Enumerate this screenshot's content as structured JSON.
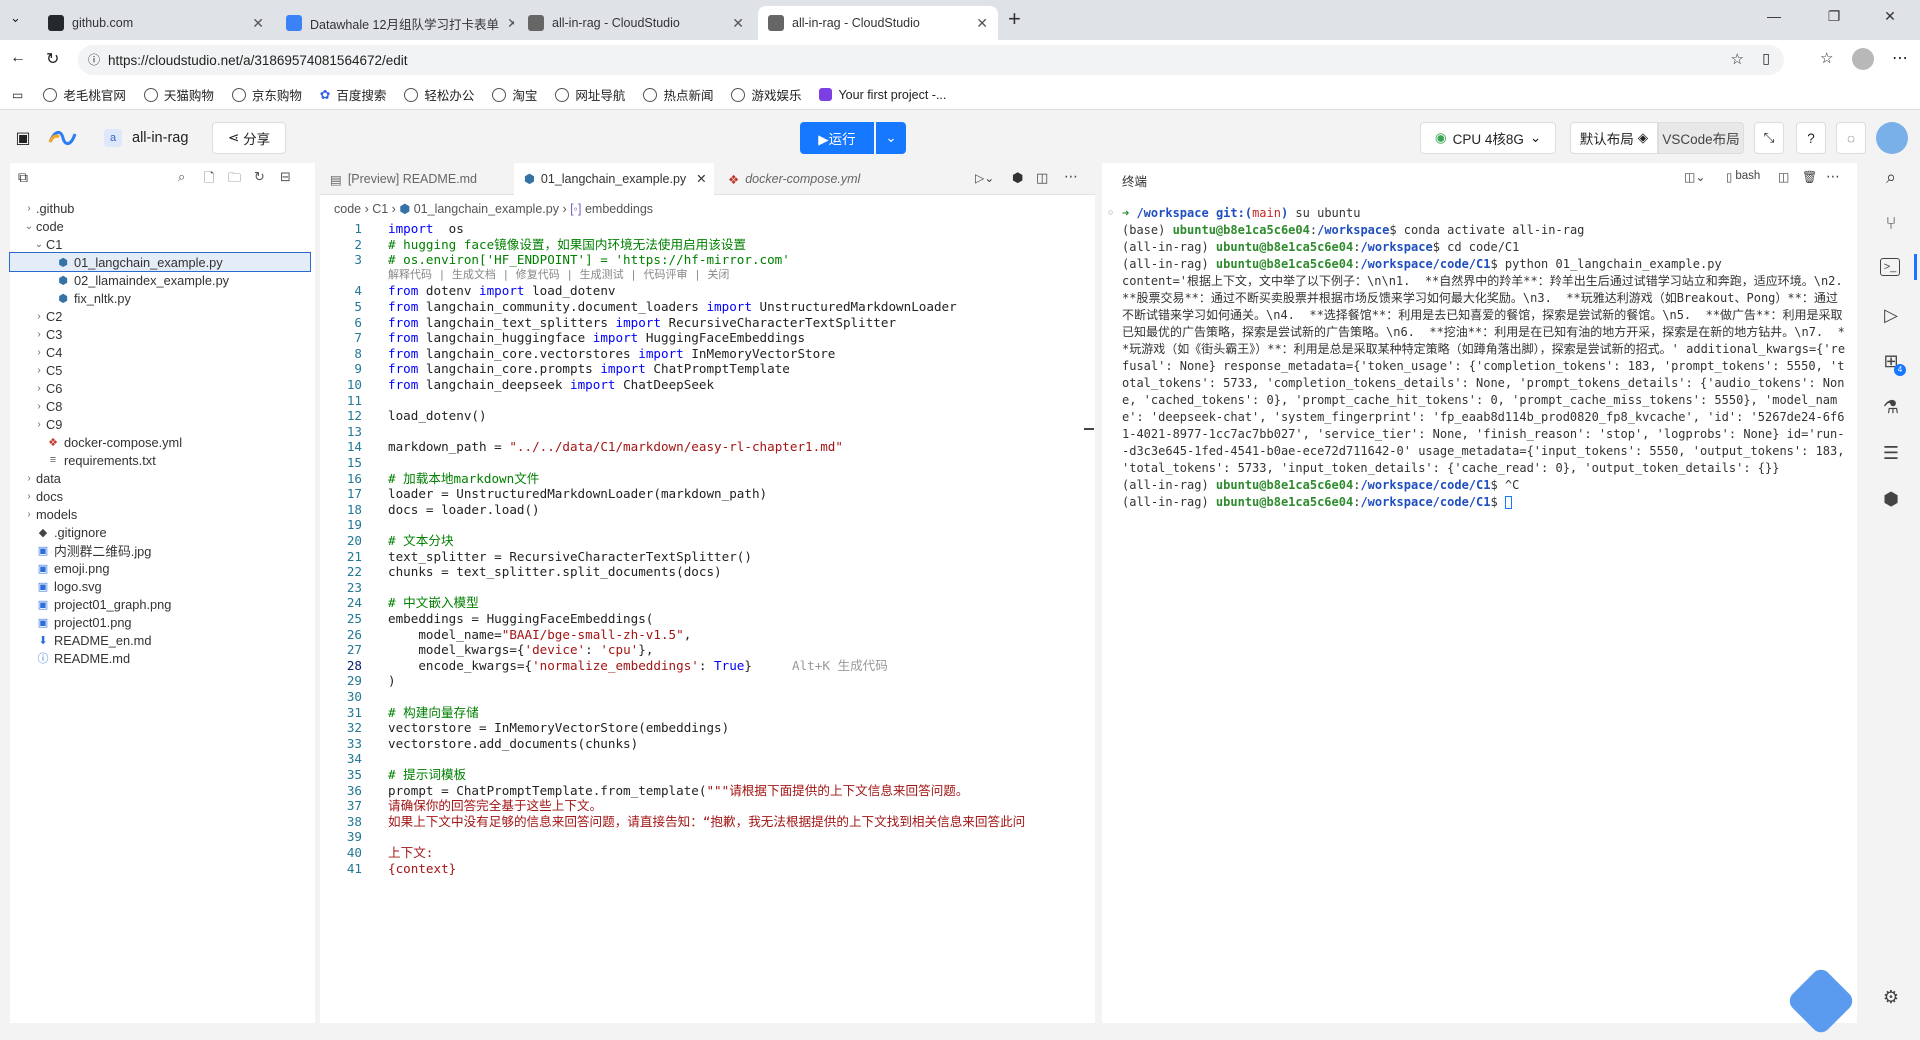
{
  "browser": {
    "tabs": [
      {
        "label": "github.com",
        "color": "#24292e"
      },
      {
        "label": "Datawhale 12月组队学习打卡表单",
        "color": "#3b82f6"
      },
      {
        "label": "all-in-rag - CloudStudio",
        "color": "#666666"
      },
      {
        "label": "all-in-rag - CloudStudio",
        "color": "#666666"
      }
    ],
    "url": "https://cloudstudio.net/a/31869574081564672/edit",
    "bookmarks": [
      "老毛桃官网",
      "天猫购物",
      "京东购物",
      "百度搜索",
      "轻松办公",
      "淘宝",
      "网址导航",
      "热点新闻",
      "游戏娱乐",
      "Your first project -..."
    ]
  },
  "app": {
    "workspace_badge": "a",
    "workspace": "all-in-rag",
    "share": "分享",
    "run": "▶运行",
    "cpu": "CPU 4核8G",
    "layout_default": "默认布局",
    "layout_vscode": "VSCode布局",
    "accent": "#1677ff"
  },
  "explorer": {
    "items": [
      {
        "label": ".github",
        "type": "folder",
        "depth": 0,
        "open": false
      },
      {
        "label": "code",
        "type": "folder",
        "depth": 0,
        "open": true
      },
      {
        "label": "C1",
        "type": "folder",
        "depth": 1,
        "open": true
      },
      {
        "label": "01_langchain_example.py",
        "type": "py",
        "depth": 2,
        "selected": true
      },
      {
        "label": "02_llamaindex_example.py",
        "type": "py",
        "depth": 2
      },
      {
        "label": "fix_nltk.py",
        "type": "py",
        "depth": 2
      },
      {
        "label": "C2",
        "type": "folder",
        "depth": 1
      },
      {
        "label": "C3",
        "type": "folder",
        "depth": 1
      },
      {
        "label": "C4",
        "type": "folder",
        "depth": 1
      },
      {
        "label": "C5",
        "type": "folder",
        "depth": 1
      },
      {
        "label": "C6",
        "type": "folder",
        "depth": 1
      },
      {
        "label": "C8",
        "type": "folder",
        "depth": 1
      },
      {
        "label": "C9",
        "type": "folder",
        "depth": 1
      },
      {
        "label": "docker-compose.yml",
        "type": "yml",
        "depth": 1
      },
      {
        "label": "requirements.txt",
        "type": "txt",
        "depth": 1
      },
      {
        "label": "data",
        "type": "folder",
        "depth": 0
      },
      {
        "label": "docs",
        "type": "folder",
        "depth": 0
      },
      {
        "label": "models",
        "type": "folder",
        "depth": 0
      },
      {
        "label": ".gitignore",
        "type": "git",
        "depth": 0
      },
      {
        "label": "内测群二维码.jpg",
        "type": "img",
        "depth": 0
      },
      {
        "label": "emoji.png",
        "type": "img",
        "depth": 0
      },
      {
        "label": "logo.svg",
        "type": "img",
        "depth": 0
      },
      {
        "label": "project01_graph.png",
        "type": "img",
        "depth": 0
      },
      {
        "label": "project01.png",
        "type": "img",
        "depth": 0
      },
      {
        "label": "README_en.md",
        "type": "md",
        "depth": 0
      },
      {
        "label": "README.md",
        "type": "info",
        "depth": 0
      }
    ]
  },
  "editor": {
    "tabs": [
      "[Preview] README.md",
      "01_langchain_example.py",
      "docker-compose.yml"
    ],
    "breadcrumb": [
      "code",
      "C1",
      "01_langchain_example.py",
      "embeddings"
    ],
    "codelens": "解释代码 | 生成文档 | 修复代码 | 生成测试 | 代码评审 | 关闭",
    "hint": "Alt+K 生成代码",
    "lines": [
      [
        [
          "kw",
          "import"
        ],
        [
          "",
          "  os"
        ]
      ],
      [
        [
          "cm",
          "# hugging face镜像设置，如果国内环境无法使用启用该设置"
        ]
      ],
      [
        [
          "cm",
          "# os.environ['HF_ENDPOINT'] = 'https://hf-mirror.com'"
        ]
      ],
      [
        [
          "kw",
          "from"
        ],
        [
          "",
          " dotenv "
        ],
        [
          "kw",
          "import"
        ],
        [
          "",
          " load_dotenv"
        ]
      ],
      [
        [
          "kw",
          "from"
        ],
        [
          "",
          " langchain_community.document_loaders "
        ],
        [
          "kw",
          "import"
        ],
        [
          "",
          " UnstructuredMarkdownLoader"
        ]
      ],
      [
        [
          "kw",
          "from"
        ],
        [
          "",
          " langchain_text_splitters "
        ],
        [
          "kw",
          "import"
        ],
        [
          "",
          " RecursiveCharacterTextSplitter"
        ]
      ],
      [
        [
          "kw",
          "from"
        ],
        [
          "",
          " langchain_huggingface "
        ],
        [
          "kw",
          "import"
        ],
        [
          "",
          " HuggingFaceEmbeddings"
        ]
      ],
      [
        [
          "kw",
          "from"
        ],
        [
          "",
          " langchain_core.vectorstores "
        ],
        [
          "kw",
          "import"
        ],
        [
          "",
          " InMemoryVectorStore"
        ]
      ],
      [
        [
          "kw",
          "from"
        ],
        [
          "",
          " langchain_core.prompts "
        ],
        [
          "kw",
          "import"
        ],
        [
          "",
          " ChatPromptTemplate"
        ]
      ],
      [
        [
          "kw",
          "from"
        ],
        [
          "",
          " langchain_deepseek "
        ],
        [
          "kw",
          "import"
        ],
        [
          "",
          " ChatDeepSeek"
        ]
      ],
      [],
      [
        [
          "",
          "load_dotenv()"
        ]
      ],
      [],
      [
        [
          "",
          "markdown_path = "
        ],
        [
          "st",
          "\"../../data/C1/markdown/easy-rl-chapter1.md\""
        ]
      ],
      [],
      [
        [
          "cm",
          "# 加载本地markdown文件"
        ]
      ],
      [
        [
          "",
          "loader = UnstructuredMarkdownLoader(markdown_path)"
        ]
      ],
      [
        [
          "",
          "docs = loader.load()"
        ]
      ],
      [],
      [
        [
          "cm",
          "# 文本分块"
        ]
      ],
      [
        [
          "",
          "text_splitter = RecursiveCharacterTextSplitter()"
        ]
      ],
      [
        [
          "",
          "chunks = text_splitter.split_documents(docs)"
        ]
      ],
      [],
      [
        [
          "cm",
          "# 中文嵌入模型"
        ]
      ],
      [
        [
          "",
          "embeddings = HuggingFaceEmbeddings("
        ]
      ],
      [
        [
          "",
          "    model_name="
        ],
        [
          "st",
          "\"BAAI/bge-small-zh-v1.5\""
        ],
        [
          "",
          ","
        ]
      ],
      [
        [
          "",
          "    model_kwargs={"
        ],
        [
          "st",
          "'device'"
        ],
        [
          "",
          ": "
        ],
        [
          "st",
          "'cpu'"
        ],
        [
          "",
          "},"
        ]
      ],
      [
        [
          "",
          "    encode_kwargs={"
        ],
        [
          "st",
          "'normalize_embeddings'"
        ],
        [
          "",
          ": "
        ],
        [
          "kw",
          "True"
        ],
        [
          "",
          "}"
        ]
      ],
      [
        [
          "",
          ")"
        ]
      ],
      [],
      [
        [
          "cm",
          "# 构建向量存储"
        ]
      ],
      [
        [
          "",
          "vectorstore = InMemoryVectorStore(embeddings)"
        ]
      ],
      [
        [
          "",
          "vectorstore.add_documents(chunks)"
        ]
      ],
      [],
      [
        [
          "cm",
          "# 提示词模板"
        ]
      ],
      [
        [
          "",
          "prompt = ChatPromptTemplate.from_template("
        ],
        [
          "st",
          "\"\"\"请根据下面提供的上下文信息来回答问题。"
        ]
      ],
      [
        [
          "st",
          "请确保你的回答完全基于这些上下文。"
        ]
      ],
      [
        [
          "st",
          "如果上下文中没有足够的信息来回答问题，请直接告知：“抱歉，我无法根据提供的上下文找到相关信息来回答此问"
        ]
      ],
      [],
      [
        [
          "st",
          "上下文:"
        ]
      ],
      [
        [
          "st",
          "{context}"
        ]
      ]
    ]
  },
  "terminal": {
    "title": "终端",
    "shell": "bash",
    "lines": [
      [
        [
          "tg",
          "➜ "
        ],
        [
          "tb",
          "/workspace "
        ],
        [
          "tb",
          "git:("
        ],
        [
          "tr",
          "main"
        ],
        [
          "tb",
          ")"
        ],
        [
          "",
          " su ubuntu"
        ]
      ],
      [
        [
          "",
          "(base) "
        ],
        [
          "tg",
          "ubuntu@b8e1ca5c6e04"
        ],
        [
          "",
          ":"
        ],
        [
          "tb",
          "/workspace"
        ],
        [
          "",
          "$ conda activate all-in-rag"
        ]
      ],
      [
        [
          "",
          "(all-in-rag) "
        ],
        [
          "tg",
          "ubuntu@b8e1ca5c6e04"
        ],
        [
          "",
          ":"
        ],
        [
          "tb",
          "/workspace"
        ],
        [
          "",
          "$ cd code/C1"
        ]
      ],
      [
        [
          "",
          "(all-in-rag) "
        ],
        [
          "tg",
          "ubuntu@b8e1ca5c6e04"
        ],
        [
          "",
          ":"
        ],
        [
          "tb",
          "/workspace/code/C1"
        ],
        [
          "",
          "$ python 01_langchain_example.py"
        ]
      ],
      [
        [
          "",
          "content='根据上下文，文中举了以下例子：\\n\\n1.  **自然界中的羚羊**：羚羊出生后通过试错学习站立和奔跑，适应环境。\\n2.  **股票交易**：通过不断买卖股票并根据市场反馈来学习如何最大化奖励。\\n3.  **玩雅达利游戏（如Breakout、Pong）**：通过不断试错来学习如何通关。\\n4.  **选择餐馆**：利用是去已知喜爱的餐馆，探索是尝试新的餐馆。\\n5.  **做广告**：利用是采取已知最优的广告策略，探索是尝试新的广告策略。\\n6.  **挖油**：利用是在已知有油的地方开采，探索是在新的地方钻井。\\n7.  **玩游戏（如《街头霸王》）**：利用是总是采取某种特定策略（如蹲角落出脚），探索是尝试新的招式。' additional_kwargs={'refusal': None} response_metadata={'token_usage': {'completion_tokens': 183, 'prompt_tokens': 5550, 'total_tokens': 5733, 'completion_tokens_details': None, 'prompt_tokens_details': {'audio_tokens': None, 'cached_tokens': 0}, 'prompt_cache_hit_tokens': 0, 'prompt_cache_miss_tokens': 5550}, 'model_name': 'deepseek-chat', 'system_fingerprint': 'fp_eaab8d114b_prod0820_fp8_kvcache', 'id': '5267de24-6f61-4021-8977-1cc7ac7bb027', 'service_tier': None, 'finish_reason': 'stop', 'logprobs': None} id='run--d3c3e645-1fed-4541-b0ae-ece72d711642-0' usage_metadata={'input_tokens': 5550, 'output_tokens': 183, 'total_tokens': 5733, 'input_token_details': {'cache_read': 0}, 'output_token_details': {}}"
        ]
      ],
      [
        [
          "",
          "(all-in-rag) "
        ],
        [
          "tg",
          "ubuntu@b8e1ca5c6e04"
        ],
        [
          "",
          ":"
        ],
        [
          "tb",
          "/workspace/code/C1"
        ],
        [
          "",
          "$ ^C"
        ]
      ],
      [
        [
          "",
          "(all-in-rag) "
        ],
        [
          "tg",
          "ubuntu@b8e1ca5c6e04"
        ],
        [
          "",
          ":"
        ],
        [
          "tb",
          "/workspace/code/C1"
        ],
        [
          "",
          "$ "
        ]
      ]
    ]
  }
}
